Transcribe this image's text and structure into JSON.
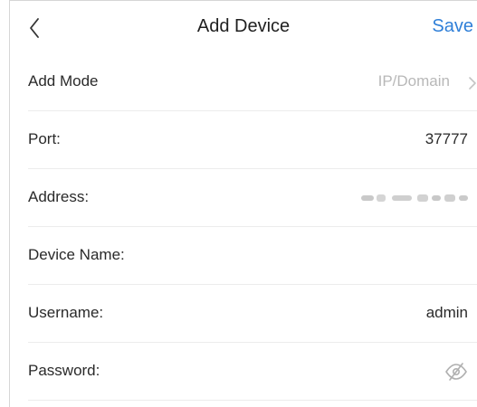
{
  "nav": {
    "title": "Add Device",
    "save_label": "Save",
    "back_icon": "chevron-left-icon"
  },
  "form": {
    "add_mode": {
      "label": "Add Mode",
      "value": "IP/Domain",
      "icon": "chevron-right-icon"
    },
    "port": {
      "label": "Port:",
      "value": "37777"
    },
    "address": {
      "label": "Address:",
      "value": ""
    },
    "device_name": {
      "label": "Device Name:",
      "value": ""
    },
    "username": {
      "label": "Username:",
      "value": "admin"
    },
    "password": {
      "label": "Password:",
      "value": "",
      "icon": "eye-slash-icon"
    }
  },
  "colors": {
    "accent": "#2f7fd8",
    "muted_text": "#b8b8b8",
    "divider": "#ececec"
  }
}
